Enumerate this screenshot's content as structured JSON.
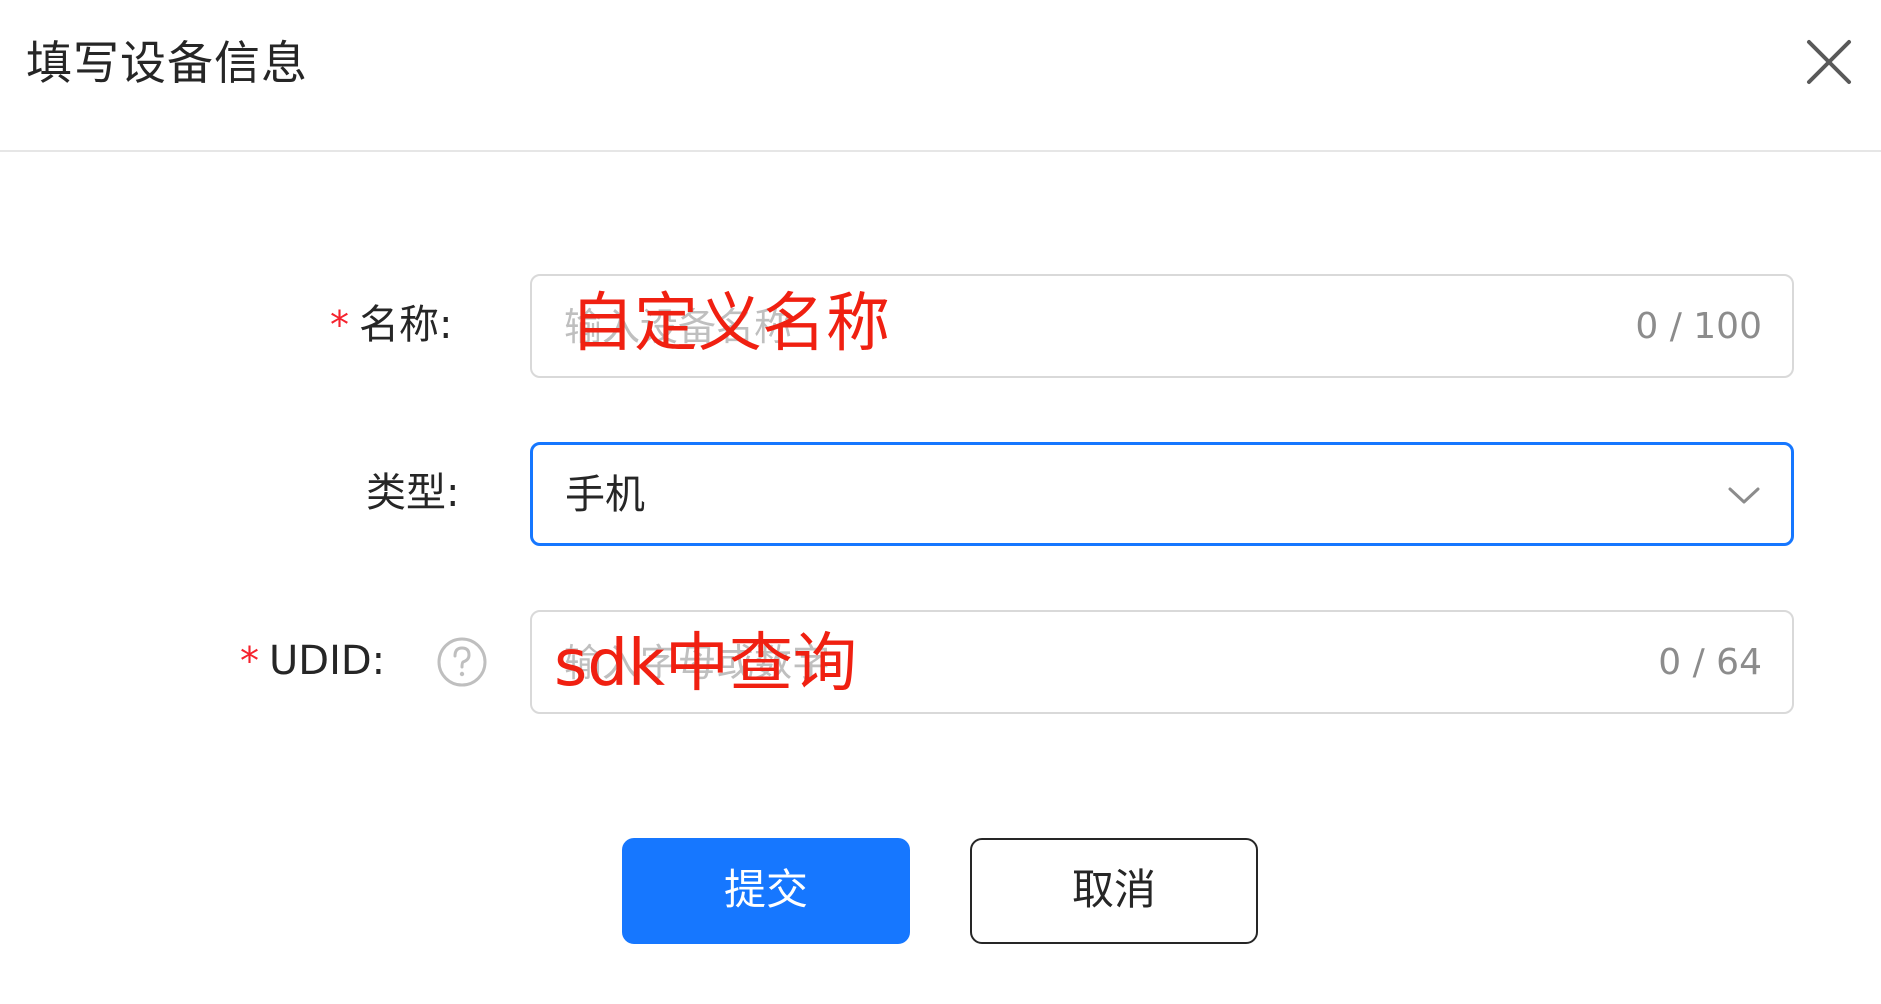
{
  "dialog": {
    "title": "填写设备信息",
    "close_icon": "close-icon"
  },
  "form": {
    "name": {
      "label": "名称:",
      "required_mark": "*",
      "placeholder": "输入设备名称",
      "counter": "0 / 100",
      "annotation": "自定义名称"
    },
    "type": {
      "label": "类型:",
      "selected_value": "手机",
      "dropdown_icon": "chevron-down-icon"
    },
    "udid": {
      "label": "UDID:",
      "required_mark": "*",
      "help_icon": "question-circle-icon",
      "placeholder": "输入字母或数字",
      "counter": "0 / 64",
      "annotation": "sdk中查询"
    }
  },
  "actions": {
    "submit_label": "提交",
    "cancel_label": "取消"
  },
  "colors": {
    "primary": "#1677ff",
    "required": "#f5222d",
    "annotation": "#f02011",
    "border": "#d9d9d9",
    "placeholder": "#bfbfbf"
  }
}
